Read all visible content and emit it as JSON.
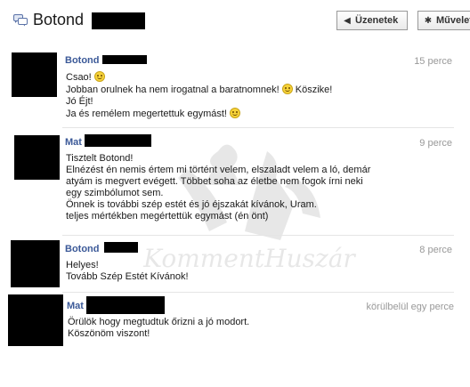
{
  "header": {
    "title": "Botond",
    "buttons": [
      {
        "label": "Üzenetek",
        "icon": "chevron-left-icon"
      },
      {
        "label": "Művelet",
        "icon": "gear-icon"
      }
    ]
  },
  "watermark": {
    "text": "KommentHuszár"
  },
  "messages": [
    {
      "sender": "Botond",
      "time": "15 perce",
      "lines": [
        {
          "text": "Csao!",
          "emoji": true
        },
        {
          "text": "Jobban orulnek ha nem irogatnal a baratnomnek!",
          "emoji": true,
          "after": "Köszike!"
        },
        {
          "text": "Jó Éjt!"
        },
        {
          "text": "Ja és remélem megertettuk egymást!",
          "emoji": true
        }
      ]
    },
    {
      "sender": "Mat",
      "time": "9 perce",
      "lines": [
        {
          "text": "Tisztelt Botond!"
        },
        {
          "text": "Elnézést én nemis értem mi történt velem, elszaladt velem a ló, demár"
        },
        {
          "text": "atyám is megvert evégett. Többet soha az életbe nem fogok írni neki"
        },
        {
          "text": "egy szimbólumot sem."
        },
        {
          "text": "Önnek is további szép estét és jó éjszakát kívánok, Uram."
        },
        {
          "text": "teljes mértékben megértettük egymást (én önt)"
        }
      ]
    },
    {
      "sender": "Botond",
      "time": "8 perce",
      "lines": [
        {
          "text": "Helyes!"
        },
        {
          "text": "Tovább Szép Estét Kívánok!"
        }
      ]
    },
    {
      "sender": "Mat",
      "time": "körülbelül egy perce",
      "lines": [
        {
          "text": "Örülök hogy megtudtuk őrizni a jó modort."
        },
        {
          "text": "Köszönöm viszont!"
        }
      ]
    }
  ]
}
